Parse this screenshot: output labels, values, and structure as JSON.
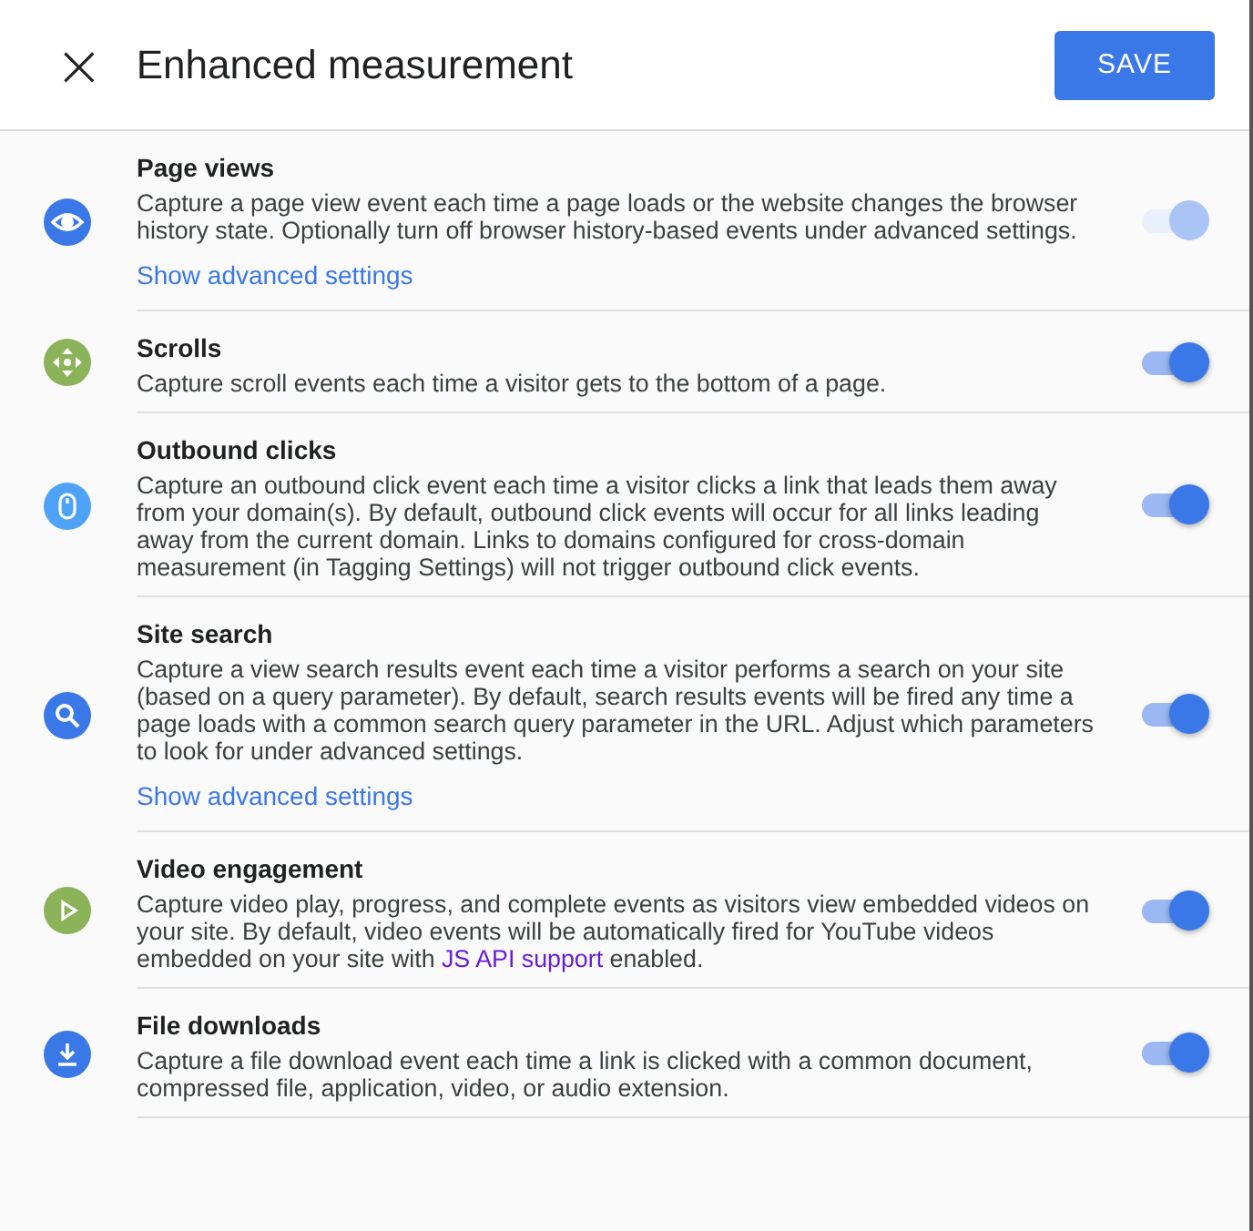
{
  "header": {
    "close": "×",
    "title": "Enhanced measurement",
    "save": "SAVE"
  },
  "events": [
    {
      "kind": "eye",
      "color": "#3b78e7",
      "title": "Page views",
      "description": [
        {
          "kind": "text",
          "text": "Capture a page view event each time a page loads or the website changes the browser history state. Optionally turn off browser history-based events under advanced settings."
        }
      ],
      "advanced_link": "Show advanced settings",
      "on": true,
      "disabled": true
    },
    {
      "kind": "scroll",
      "color": "#8bb35a",
      "title": "Scrolls",
      "description": [
        {
          "kind": "text",
          "text": "Capture scroll events each time a visitor gets to the bottom of a page."
        }
      ],
      "on": true,
      "disabled": false
    },
    {
      "kind": "mouse",
      "color": "#4fa3f7",
      "title": "Outbound clicks",
      "description": [
        {
          "kind": "text",
          "text": "Capture an outbound click event each time a visitor clicks a link that leads them away from your domain(s). By default, outbound click events will occur for all links leading away from the current domain. Links to domains configured for cross-domain measurement (in Tagging Settings) will not trigger outbound click events."
        }
      ],
      "on": true,
      "disabled": false
    },
    {
      "kind": "search",
      "color": "#3b78e7",
      "title": "Site search",
      "description": [
        {
          "kind": "text",
          "text": "Capture a view search results event each time a visitor performs a search on your site (based on a query parameter). By default, search results events will be fired any time a page loads with a common search query parameter in the URL. Adjust which parameters to look for under advanced settings."
        }
      ],
      "advanced_link": "Show advanced settings",
      "on": true,
      "disabled": false
    },
    {
      "kind": "play",
      "color": "#8bb35a",
      "title": "Video engagement",
      "description": [
        {
          "kind": "text",
          "text": "Capture video play, progress, and complete events as visitors view embedded videos on your site. By default, video events will be automatically fired for YouTube videos embedded on your site with "
        },
        {
          "kind": "link",
          "text": "JS API support"
        },
        {
          "kind": "text",
          "text": " enabled."
        }
      ],
      "on": true,
      "disabled": false
    },
    {
      "kind": "download",
      "color": "#3b78e7",
      "title": "File downloads",
      "description": [
        {
          "kind": "text",
          "text": "Capture a file download event each time a link is clicked with a common document, compressed file, application, video, or audio extension."
        }
      ],
      "on": true,
      "disabled": false
    }
  ]
}
